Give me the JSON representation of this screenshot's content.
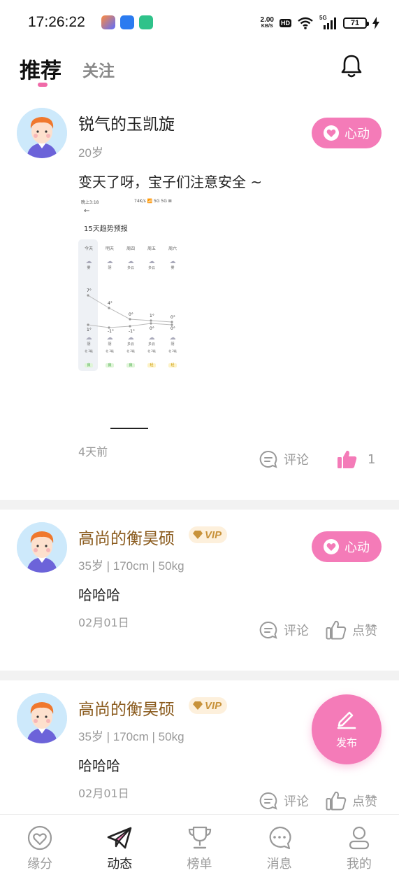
{
  "status_bar": {
    "time": "17:26:22",
    "net_speed_value": "2.00",
    "net_speed_unit": "KB/S",
    "hd": "HD",
    "signal": "5G",
    "battery": "71"
  },
  "header": {
    "tab_active": "推荐",
    "tab_inactive": "关注",
    "bell_icon": "bell-icon"
  },
  "posts": [
    {
      "name": "锐气的玉凯旋",
      "meta": "20岁",
      "content": "变天了呀，宝子们注意安全 ~",
      "time": "4天前",
      "heart_label": "心动",
      "comment_label": "评论",
      "like_label": "1",
      "liked": true,
      "image": {
        "header_left": "晚上3:18",
        "header_right": "74K/s 📶 5G 5G ⊠",
        "title": "15天趋势预报",
        "col_head": [
          "今天",
          "明天",
          "周四",
          "周五",
          "周六"
        ],
        "weather_hi": [
          "雾",
          "阴",
          "多云",
          "多云",
          "雾"
        ],
        "temp_hi": [
          "7°",
          "4°",
          "0°",
          "1°",
          "0°"
        ],
        "temp_lo": [
          "1°",
          "-1°",
          "-1°",
          "0°",
          "0°"
        ],
        "weather_lo": [
          "阴",
          "阴",
          "多云",
          "多云",
          "阴"
        ],
        "wind": [
          "北 3级",
          "北 3级",
          "北 2级",
          "北 2级",
          "北 2级"
        ],
        "aqi": [
          "良",
          "良",
          "良",
          "轻",
          "轻"
        ]
      }
    },
    {
      "name": "高尚的衡昊硕",
      "vip": "VIP",
      "meta": "35岁 | 170cm | 50kg",
      "content": "哈哈哈",
      "time": "02月01日",
      "heart_label": "心动",
      "comment_label": "评论",
      "like_label": "点赞"
    },
    {
      "name": "高尚的衡昊硕",
      "vip": "VIP",
      "meta": "35岁 | 170cm | 50kg",
      "content": "哈哈哈",
      "time": "02月01日",
      "comment_label": "评论",
      "like_label": "点赞"
    }
  ],
  "fab": {
    "label": "发布"
  },
  "bottom_nav": [
    {
      "label": "缘分",
      "icon": "heart-circle-icon"
    },
    {
      "label": "动态",
      "icon": "paper-plane-icon",
      "active": true
    },
    {
      "label": "榜单",
      "icon": "trophy-icon"
    },
    {
      "label": "消息",
      "icon": "chat-bubble-icon"
    },
    {
      "label": "我的",
      "icon": "person-icon"
    }
  ],
  "colors": {
    "accent_pink": "#f47bb8",
    "vip_gold": "#c8923a",
    "vip_name": "#8a5a1c"
  }
}
